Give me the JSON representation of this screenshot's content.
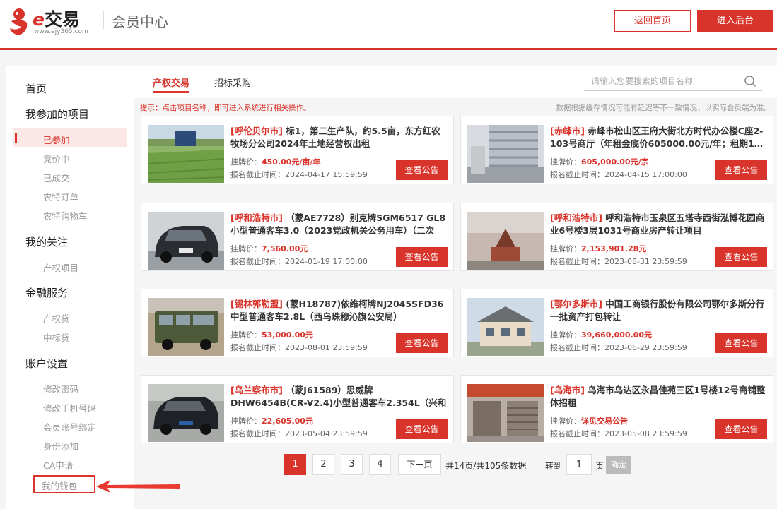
{
  "header": {
    "logo_text": "交易",
    "logo_e": "e",
    "logo_url": "www.ejy365.com",
    "title": "会员中心",
    "home_label": "返回首页",
    "admin_label": "进入后台"
  },
  "sidebar": {
    "home": "首页",
    "my_projects": "我参加的项目",
    "project_items": [
      "已参加",
      "竞价中",
      "已成交",
      "农特订单",
      "农特购物车"
    ],
    "my_follow": "我的关注",
    "follow_items": [
      "产权项目"
    ],
    "finance": "金融服务",
    "finance_items": [
      "产权贷",
      "中标贷"
    ],
    "account": "账户设置",
    "account_items": [
      "修改密码",
      "修改手机号码",
      "会员账号绑定",
      "身份添加",
      "CA申请",
      "我的钱包"
    ]
  },
  "tabs": [
    "产权交易",
    "招标采购"
  ],
  "search": {
    "placeholder": "请输入您要搜索的项目名称"
  },
  "hint": "提示：点击项目名称，即可进入系统进行相关操作。",
  "note": "数据根据缓存情况可能有延迟等不一致情况，以实际会员端为准。",
  "labels": {
    "price": "挂牌价：",
    "deadline": "报名截止时间：",
    "view": "查看公告"
  },
  "cards": [
    {
      "region": "[呼伦贝尔市]",
      "title": "标1，第二生产队，约5.5亩，东方红农牧场分公司2024年土地经营权出租",
      "price": "450.00元/亩/年",
      "deadline": "2024-04-17 15:59:59"
    },
    {
      "region": "[赤峰市]",
      "title": "赤峰市松山区王府大街北方时代办公楼C座2-103号商厅（年租金底价605000.00元/年；租期1…",
      "price": "605,000.00元/宗",
      "deadline": "2024-04-15 17:00:00"
    },
    {
      "region": "[呼和浩特市]",
      "title": "（蒙AE7728）别克牌SGM6517 GL8小型普通客车3.0（2023党政机关公务用车）（二次挂…",
      "price": "7,560.00元",
      "deadline": "2024-01-19 17:00:00"
    },
    {
      "region": "[呼和浩特市]",
      "title": "呼和浩特市玉泉区五塔寺西街泓博花园商业6号楼3层1031号商业房产转让项目",
      "price": "2,153,901.28元",
      "deadline": "2023-08-31 23:59:59"
    },
    {
      "region": "[锡林郭勒盟]",
      "title": "(蒙H18787)依维柯牌NJ2045SFD36中型普通客车2.8L（西乌珠穆沁旗公安局）",
      "price": "53,000.00元",
      "deadline": "2023-08-01 23:59:59"
    },
    {
      "region": "[鄂尔多斯市]",
      "title": "中国工商银行股份有限公司鄂尔多斯分行一批资产打包转让",
      "price": "39,660,000.00元",
      "deadline": "2023-06-29 23:59:59"
    },
    {
      "region": "[乌兰察布市]",
      "title": "（蒙J61589）思威牌DHW6454B(CR-V2.4)小型普通客车2.354L（兴和县医院）（国资监…",
      "price": "22,605.00元",
      "deadline": "2023-05-04 23:59:59"
    },
    {
      "region": "[乌海市]",
      "title": "乌海市乌达区永昌佳苑三区1号楼12号商铺整体招租",
      "price": "详见交易公告",
      "deadline": "2023-05-08 23:59:59"
    }
  ],
  "pager": {
    "pages": [
      "1",
      "2",
      "3",
      "4"
    ],
    "next": "下一页",
    "summary": "共14页/共105条数据",
    "goto": "转到",
    "goto_value": "1",
    "unit": "页",
    "ok": "确定"
  },
  "colors": {
    "accent": "#d9342b"
  }
}
